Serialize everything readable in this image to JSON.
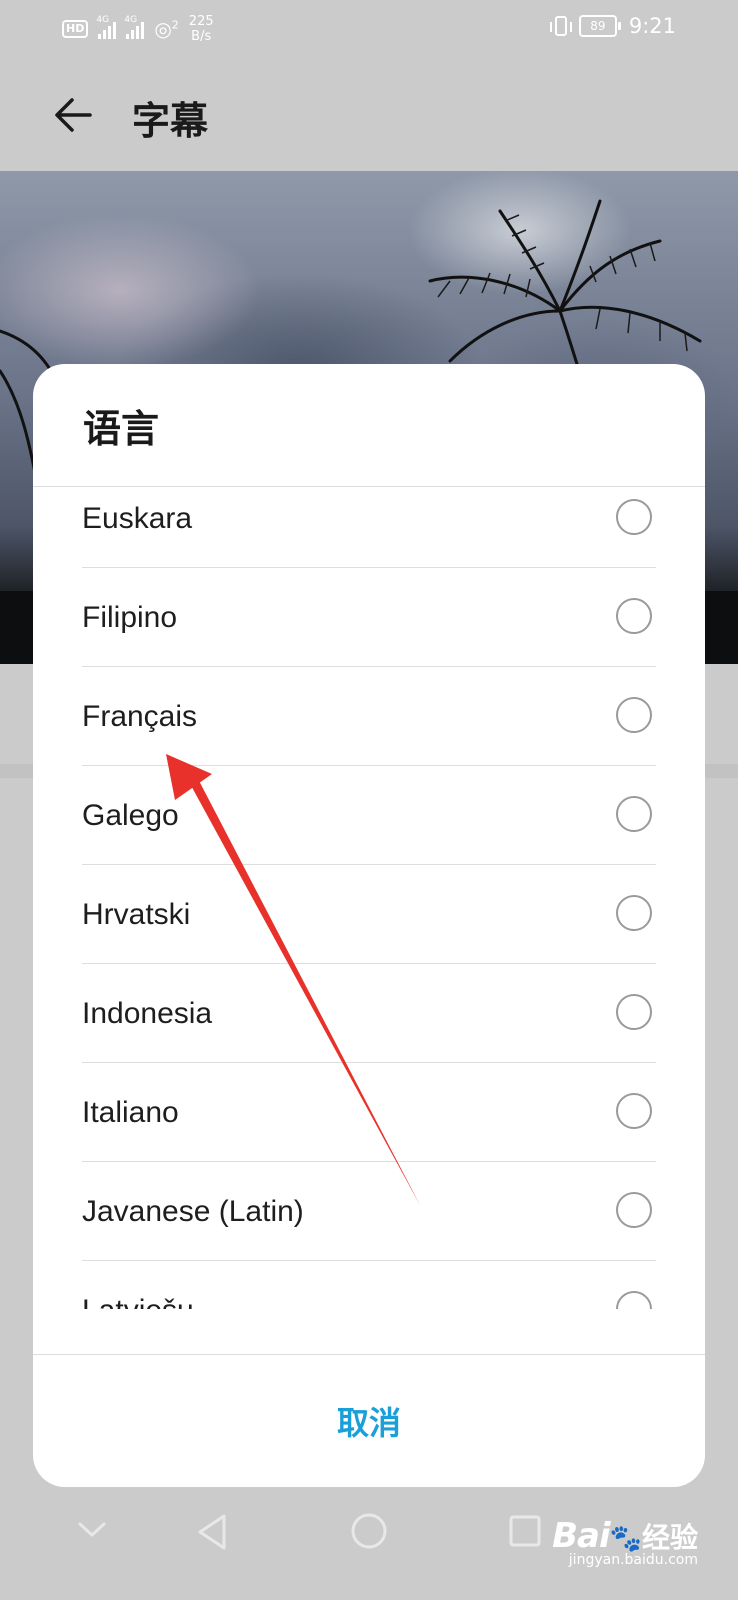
{
  "status_bar": {
    "hd": "HD",
    "sim1_tag": "4G",
    "sim2_tag": "4G",
    "hotspot_count": "2",
    "speed_value": "225",
    "speed_unit": "B/s",
    "battery": "89",
    "time": "9:21"
  },
  "toolbar": {
    "title": "字幕"
  },
  "dialog": {
    "title": "语言",
    "options": [
      {
        "label": "Euskara",
        "selected": false
      },
      {
        "label": "Filipino",
        "selected": false
      },
      {
        "label": "Français",
        "selected": false
      },
      {
        "label": "Galego",
        "selected": false
      },
      {
        "label": "Hrvatski",
        "selected": false
      },
      {
        "label": "Indonesia",
        "selected": false
      },
      {
        "label": "Italiano",
        "selected": false
      },
      {
        "label": "Javanese (Latin)",
        "selected": false
      },
      {
        "label": "Latviešu",
        "selected": false
      }
    ],
    "cancel_label": "取消"
  },
  "watermark": {
    "brand": "Bai",
    "brand2": "经验",
    "url": "jingyan.baidu.com"
  },
  "colors": {
    "accent": "#1a9fd9",
    "annotation_arrow": "#e8312a",
    "scrim": "#cbcbcb"
  }
}
